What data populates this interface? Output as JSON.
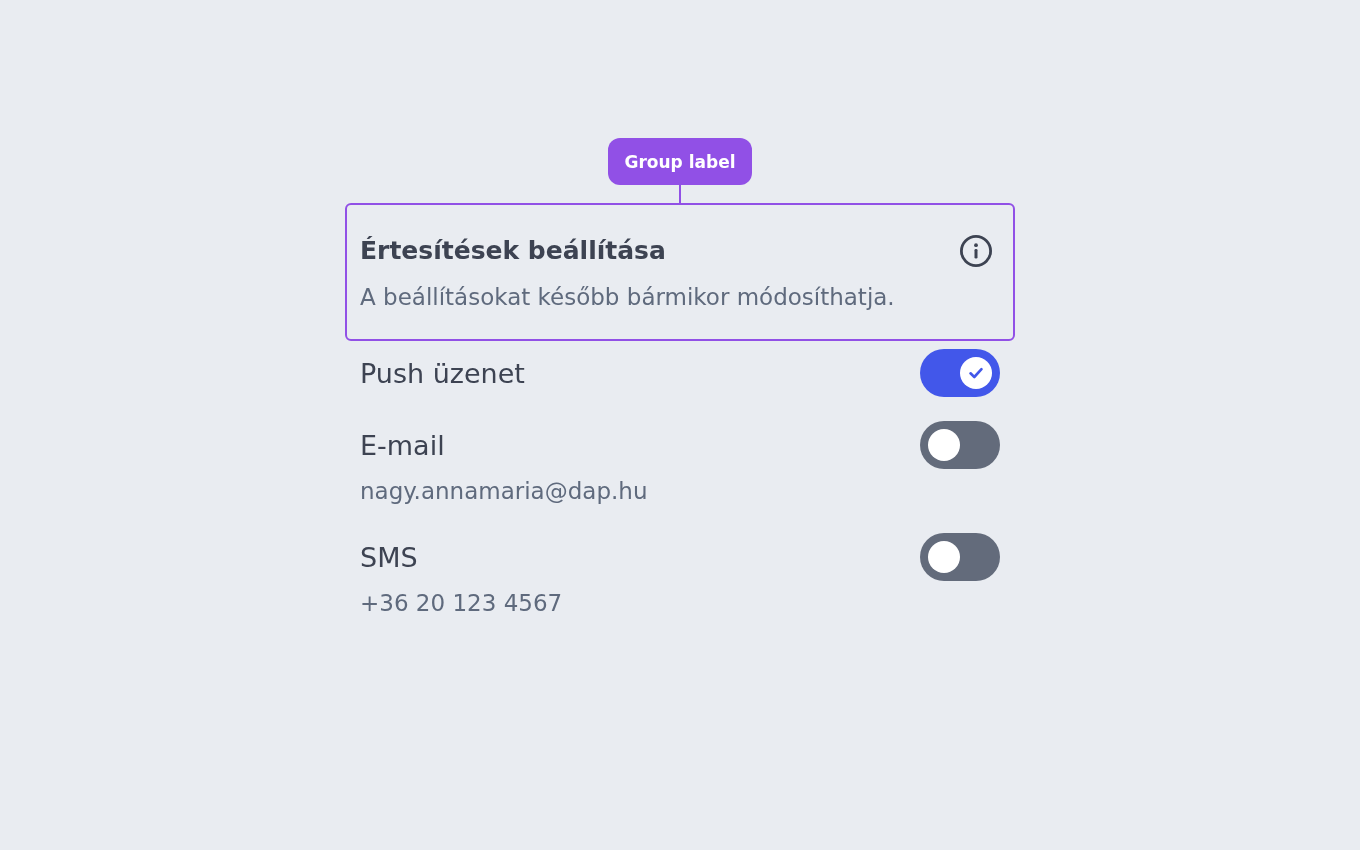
{
  "annotation": {
    "label": "Group label"
  },
  "group": {
    "title": "Értesítések beállítása",
    "description": "A beállításokat később bármikor módosíthatja."
  },
  "channels": [
    {
      "label": "Push üzenet",
      "on": true
    },
    {
      "label": "E-mail",
      "detail": "nagy.annamaria@dap.hu",
      "on": false
    },
    {
      "label": "SMS",
      "detail": "+36 20 123 4567",
      "on": false
    }
  ]
}
